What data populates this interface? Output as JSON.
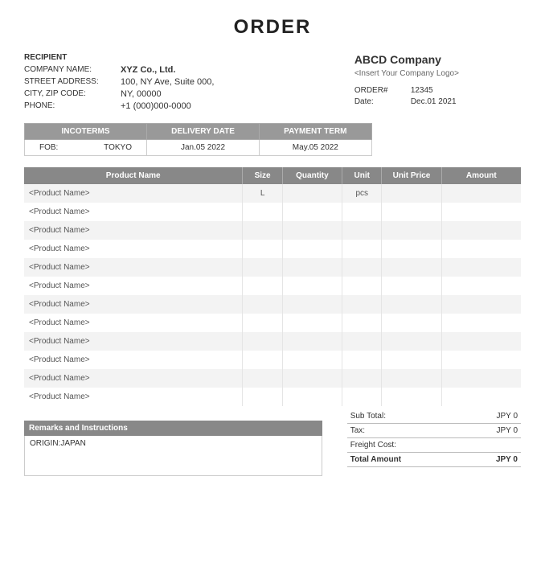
{
  "title": "ORDER",
  "recipient": {
    "section": "RECIPIENT",
    "labels": {
      "company": "COMPANY NAME:",
      "street": "STREET ADDRESS:",
      "cityzip": "CITY, ZIP CODE:",
      "phone": "PHONE:"
    },
    "company": "XYZ Co., Ltd.",
    "street": "100, NY Ave, Suite 000,",
    "cityzip": "NY, 00000",
    "phone": "+1 (000)000-0000"
  },
  "sender": {
    "company": "ABCD Company",
    "logo_placeholder": "<Insert Your Company Logo>",
    "order_label": "ORDER#",
    "order_value": "12345",
    "date_label": "Date:",
    "date_value": "Dec.01 2021"
  },
  "terms": {
    "headers": {
      "incoterms": "INCOTERMS",
      "delivery": "DELIVERY DATE",
      "payment": "PAYMENT TERM"
    },
    "fob_label": "FOB:",
    "fob_value": "TOKYO",
    "delivery": "Jan.05 2022",
    "payment": "May.05 2022"
  },
  "products": {
    "headers": {
      "name": "Product Name",
      "size": "Size",
      "qty": "Quantity",
      "unit": "Unit",
      "price": "Unit Price",
      "amount": "Amount"
    },
    "rows": [
      {
        "name": "<Product Name>",
        "size": "L",
        "qty": "",
        "unit": "pcs",
        "price": "",
        "amount": ""
      },
      {
        "name": "<Product Name>",
        "size": "",
        "qty": "",
        "unit": "",
        "price": "",
        "amount": ""
      },
      {
        "name": "<Product Name>",
        "size": "",
        "qty": "",
        "unit": "",
        "price": "",
        "amount": ""
      },
      {
        "name": "<Product Name>",
        "size": "",
        "qty": "",
        "unit": "",
        "price": "",
        "amount": ""
      },
      {
        "name": "<Product Name>",
        "size": "",
        "qty": "",
        "unit": "",
        "price": "",
        "amount": ""
      },
      {
        "name": "<Product Name>",
        "size": "",
        "qty": "",
        "unit": "",
        "price": "",
        "amount": ""
      },
      {
        "name": "<Product Name>",
        "size": "",
        "qty": "",
        "unit": "",
        "price": "",
        "amount": ""
      },
      {
        "name": "<Product Name>",
        "size": "",
        "qty": "",
        "unit": "",
        "price": "",
        "amount": ""
      },
      {
        "name": "<Product Name>",
        "size": "",
        "qty": "",
        "unit": "",
        "price": "",
        "amount": ""
      },
      {
        "name": "<Product Name>",
        "size": "",
        "qty": "",
        "unit": "",
        "price": "",
        "amount": ""
      },
      {
        "name": "<Product Name>",
        "size": "",
        "qty": "",
        "unit": "",
        "price": "",
        "amount": ""
      },
      {
        "name": "<Product Name>",
        "size": "",
        "qty": "",
        "unit": "",
        "price": "",
        "amount": ""
      }
    ]
  },
  "totals": {
    "subtotal_label": "Sub Total:",
    "subtotal_value": "JPY 0",
    "tax_label": "Tax:",
    "tax_value": "JPY 0",
    "freight_label": "Freight Cost:",
    "freight_value": "",
    "total_label": "Total Amount",
    "total_value": "JPY 0"
  },
  "remarks": {
    "header": "Remarks and Instructions",
    "body": "ORIGIN:JAPAN"
  }
}
